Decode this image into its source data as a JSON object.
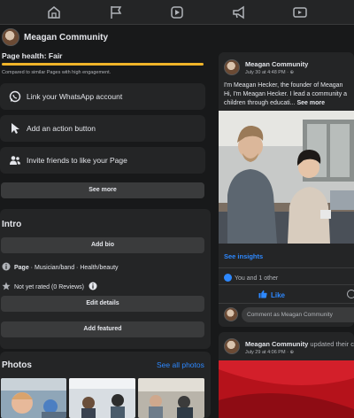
{
  "nav": {
    "icons": [
      "home-icon",
      "flag-icon",
      "watch-icon",
      "megaphone-icon",
      "video-icon"
    ]
  },
  "page": {
    "name": "Meagan Community"
  },
  "health": {
    "title": "Page health: Fair",
    "subtitle": "Compared to similar Pages with high engagement.",
    "level_percent": 100
  },
  "actions": [
    {
      "label": "Link your WhatsApp account",
      "icon": "whatsapp-icon"
    },
    {
      "label": "Add an action button",
      "icon": "cursor-icon"
    },
    {
      "label": "Invite friends to like your Page",
      "icon": "people-icon"
    }
  ],
  "see_more_label": "See more",
  "intro": {
    "title": "Intro",
    "add_bio_label": "Add bio",
    "page_prefix": "Page",
    "categories": " · Musician/band · Health/beauty",
    "rating": "Not yet rated (0 Reviews)",
    "edit_details_label": "Edit details",
    "add_featured_label": "Add featured"
  },
  "photos": {
    "title": "Photos",
    "see_all_label": "See all photos"
  },
  "post1": {
    "author": "Meagan Community",
    "time": "July 30 at 4:48 PM · ",
    "line1": "I'm Meagan Hecker, the founder of Meagan",
    "line2": "Hi, I'm Meagan Hecker. I lead a community a",
    "line3": "children through educati... ",
    "see_more": "See more",
    "insights_label": "See insights",
    "reactions": "You and 1 other",
    "like_label": "Like",
    "comment_placeholder": "Comment as Meagan Community"
  },
  "post2": {
    "author": "Meagan Community",
    "action": " updated their co",
    "time": "July 29 at 4:06 PM · "
  },
  "colors": {
    "background": "#18191a",
    "card": "#242526",
    "button": "#3a3b3c",
    "link": "#2d88ff",
    "health": "#f0b429"
  }
}
